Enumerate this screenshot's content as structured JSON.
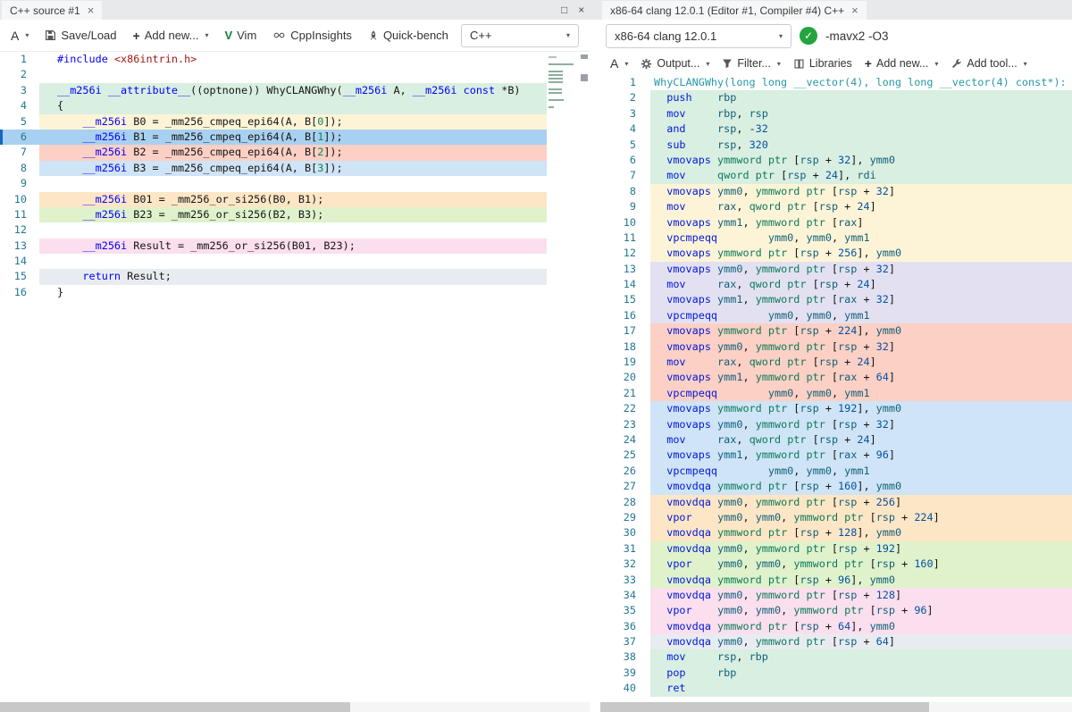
{
  "colors": {
    "teal": "#d9efe1",
    "yellow": "#fdf4d7",
    "sel": "#a8d0f0",
    "salmon": "#fcd0c4",
    "blue": "#cfe4f6",
    "orange": "#fde6c5",
    "green": "#dff2cc",
    "pink": "#fbdfee",
    "gray": "#e8ecf1",
    "lav": "#e3e1f1",
    "check_green": "#23a43f",
    "selected_line_bar": "#1766c0"
  },
  "glyphs": {
    "caret": "▾",
    "plus": "+",
    "close": "×",
    "maximize": "□",
    "check": "✓",
    "vim_v": "V"
  },
  "window": {
    "source_tab": "C++ source #1",
    "compiler_tab": "x86-64 clang 12.0.1 (Editor #1, Compiler #4) C++"
  },
  "source_pane": {
    "toolbar": {
      "font_menu": "A",
      "save_load": "Save/Load",
      "add_new": "Add new...",
      "vim": "Vim",
      "cppinsights": "CppInsights",
      "quick_bench": "Quick-bench",
      "language": "C++"
    },
    "lines": [
      {
        "n": 1,
        "t": "#include <x86intrin.h>",
        "c": "none"
      },
      {
        "n": 2,
        "t": "",
        "c": "none"
      },
      {
        "n": 3,
        "t": "__m256i __attribute__((optnone)) WhyCLANGWhy(__m256i A, __m256i const *B)",
        "c": "teal"
      },
      {
        "n": 4,
        "t": "{",
        "c": "teal"
      },
      {
        "n": 5,
        "t": "    __m256i B0 = _mm256_cmpeq_epi64(A, B[0]);",
        "c": "yellow"
      },
      {
        "n": 6,
        "t": "    __m256i B1 = _mm256_cmpeq_epi64(A, B[1]);",
        "c": "sel",
        "sel": true
      },
      {
        "n": 7,
        "t": "    __m256i B2 = _mm256_cmpeq_epi64(A, B[2]);",
        "c": "salmon"
      },
      {
        "n": 8,
        "t": "    __m256i B3 = _mm256_cmpeq_epi64(A, B[3]);",
        "c": "blue"
      },
      {
        "n": 9,
        "t": "",
        "c": "none"
      },
      {
        "n": 10,
        "t": "    __m256i B01 = _mm256_or_si256(B0, B1);",
        "c": "orange"
      },
      {
        "n": 11,
        "t": "    __m256i B23 = _mm256_or_si256(B2, B3);",
        "c": "green"
      },
      {
        "n": 12,
        "t": "",
        "c": "none"
      },
      {
        "n": 13,
        "t": "    __m256i Result = _mm256_or_si256(B01, B23);",
        "c": "pink"
      },
      {
        "n": 14,
        "t": "",
        "c": "none"
      },
      {
        "n": 15,
        "t": "    return Result;",
        "c": "gray"
      },
      {
        "n": 16,
        "t": "}",
        "c": "none"
      }
    ]
  },
  "compiler_pane": {
    "toolbar": {
      "compiler_name": "x86-64 clang 12.0.1",
      "options": "-mavx2 -O3"
    },
    "toolbar2": {
      "font_menu": "A",
      "output": "Output...",
      "filter": "Filter...",
      "libraries": "Libraries",
      "add_new": "Add new...",
      "add_tool": "Add tool..."
    },
    "lines": [
      {
        "n": 1,
        "t": "WhyCLANGWhy(long long __vector(4), long long __vector(4) const*):",
        "c": "none",
        "lbl": true
      },
      {
        "n": 2,
        "t": "  push    rbp",
        "c": "teal"
      },
      {
        "n": 3,
        "t": "  mov     rbp, rsp",
        "c": "teal"
      },
      {
        "n": 4,
        "t": "  and     rsp, -32",
        "c": "teal"
      },
      {
        "n": 5,
        "t": "  sub     rsp, 320",
        "c": "teal"
      },
      {
        "n": 6,
        "t": "  vmovaps ymmword ptr [rsp + 32], ymm0",
        "c": "teal"
      },
      {
        "n": 7,
        "t": "  mov     qword ptr [rsp + 24], rdi",
        "c": "teal"
      },
      {
        "n": 8,
        "t": "  vmovaps ymm0, ymmword ptr [rsp + 32]",
        "c": "yellow"
      },
      {
        "n": 9,
        "t": "  mov     rax, qword ptr [rsp + 24]",
        "c": "yellow"
      },
      {
        "n": 10,
        "t": "  vmovaps ymm1, ymmword ptr [rax]",
        "c": "yellow"
      },
      {
        "n": 11,
        "t": "  vpcmpeqq        ymm0, ymm0, ymm1",
        "c": "yellow"
      },
      {
        "n": 12,
        "t": "  vmovaps ymmword ptr [rsp + 256], ymm0",
        "c": "yellow"
      },
      {
        "n": 13,
        "t": "  vmovaps ymm0, ymmword ptr [rsp + 32]",
        "c": "lav"
      },
      {
        "n": 14,
        "t": "  mov     rax, qword ptr [rsp + 24]",
        "c": "lav"
      },
      {
        "n": 15,
        "t": "  vmovaps ymm1, ymmword ptr [rax + 32]",
        "c": "lav"
      },
      {
        "n": 16,
        "t": "  vpcmpeqq        ymm0, ymm0, ymm1",
        "c": "lav"
      },
      {
        "n": 17,
        "t": "  vmovaps ymmword ptr [rsp + 224], ymm0",
        "c": "salmon"
      },
      {
        "n": 18,
        "t": "  vmovaps ymm0, ymmword ptr [rsp + 32]",
        "c": "salmon"
      },
      {
        "n": 19,
        "t": "  mov     rax, qword ptr [rsp + 24]",
        "c": "salmon"
      },
      {
        "n": 20,
        "t": "  vmovaps ymm1, ymmword ptr [rax + 64]",
        "c": "salmon"
      },
      {
        "n": 21,
        "t": "  vpcmpeqq        ymm0, ymm0, ymm1",
        "c": "salmon"
      },
      {
        "n": 22,
        "t": "  vmovaps ymmword ptr [rsp + 192], ymm0",
        "c": "blue"
      },
      {
        "n": 23,
        "t": "  vmovaps ymm0, ymmword ptr [rsp + 32]",
        "c": "blue"
      },
      {
        "n": 24,
        "t": "  mov     rax, qword ptr [rsp + 24]",
        "c": "blue"
      },
      {
        "n": 25,
        "t": "  vmovaps ymm1, ymmword ptr [rax + 96]",
        "c": "blue"
      },
      {
        "n": 26,
        "t": "  vpcmpeqq        ymm0, ymm0, ymm1",
        "c": "blue"
      },
      {
        "n": 27,
        "t": "  vmovdqa ymmword ptr [rsp + 160], ymm0",
        "c": "blue"
      },
      {
        "n": 28,
        "t": "  vmovdqa ymm0, ymmword ptr [rsp + 256]",
        "c": "orange"
      },
      {
        "n": 29,
        "t": "  vpor    ymm0, ymm0, ymmword ptr [rsp + 224]",
        "c": "orange"
      },
      {
        "n": 30,
        "t": "  vmovdqa ymmword ptr [rsp + 128], ymm0",
        "c": "orange"
      },
      {
        "n": 31,
        "t": "  vmovdqa ymm0, ymmword ptr [rsp + 192]",
        "c": "green"
      },
      {
        "n": 32,
        "t": "  vpor    ymm0, ymm0, ymmword ptr [rsp + 160]",
        "c": "green"
      },
      {
        "n": 33,
        "t": "  vmovdqa ymmword ptr [rsp + 96], ymm0",
        "c": "green"
      },
      {
        "n": 34,
        "t": "  vmovdqa ymm0, ymmword ptr [rsp + 128]",
        "c": "pink"
      },
      {
        "n": 35,
        "t": "  vpor    ymm0, ymm0, ymmword ptr [rsp + 96]",
        "c": "pink"
      },
      {
        "n": 36,
        "t": "  vmovdqa ymmword ptr [rsp + 64], ymm0",
        "c": "pink"
      },
      {
        "n": 37,
        "t": "  vmovdqa ymm0, ymmword ptr [rsp + 64]",
        "c": "gray"
      },
      {
        "n": 38,
        "t": "  mov     rsp, rbp",
        "c": "teal"
      },
      {
        "n": 39,
        "t": "  pop     rbp",
        "c": "teal"
      },
      {
        "n": 40,
        "t": "  ret",
        "c": "teal"
      }
    ]
  }
}
